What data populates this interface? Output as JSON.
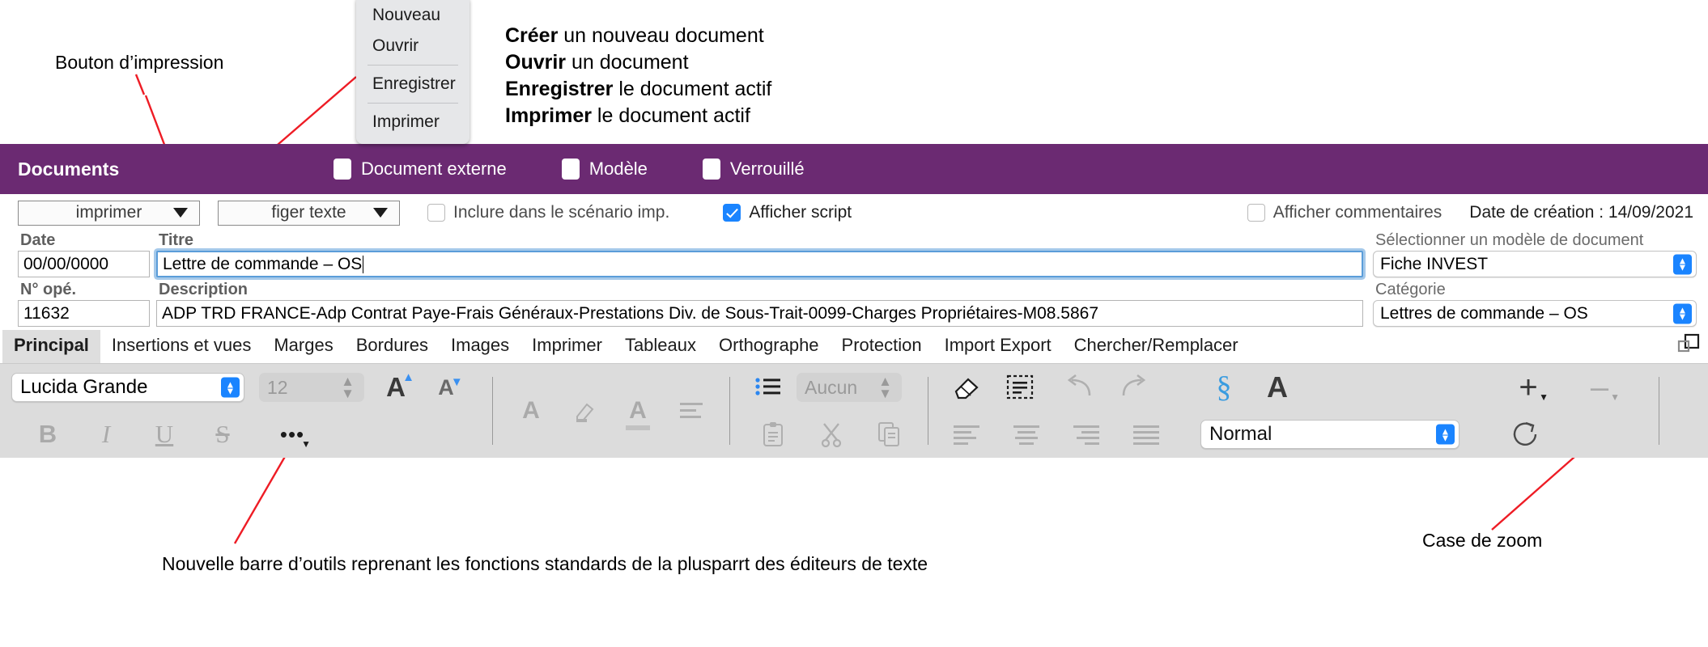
{
  "annotations": {
    "print_button": "Bouton d’impression",
    "toolbar_note": "Nouvelle barre d’outils reprenant les fonctions standards de la plusparrt des éditeurs de texte",
    "zoom_case": "Case de zoom"
  },
  "legend": [
    {
      "bold": "Créer",
      "rest": " un nouveau document"
    },
    {
      "bold": "Ouvrir",
      "rest": " un document"
    },
    {
      "bold": "Enregistrer",
      "rest": " le document actif"
    },
    {
      "bold": "Imprimer",
      "rest": " le document actif"
    }
  ],
  "menu": {
    "items": [
      {
        "label": "Nouveau",
        "sep_after": false
      },
      {
        "label": "Ouvrir",
        "sep_after": true
      },
      {
        "label": "Enregistrer",
        "sep_after": true
      },
      {
        "label": "Imprimer",
        "sep_after": false
      }
    ]
  },
  "titlebar": {
    "title": "Documents",
    "accent_color": "#6b2a72",
    "checks": [
      {
        "label": "Document externe",
        "checked": false
      },
      {
        "label": "Modèle",
        "checked": false
      },
      {
        "label": "Verrouillé",
        "checked": false
      }
    ]
  },
  "options": {
    "action_pulldown": "imprimer",
    "text_pulldown": "figer texte",
    "include_scenario": {
      "label": "Inclure dans le scénario imp.",
      "checked": false
    },
    "show_script": {
      "label": "Afficher script",
      "checked": true
    },
    "show_comments": {
      "label": "Afficher commentaires",
      "checked": false
    },
    "creation_date": "Date de création : 14/09/2021"
  },
  "fields": {
    "date_label": "Date",
    "date_value": "00/00/0000",
    "title_label": "Titre",
    "title_value": "Lettre de commande – OS",
    "ope_label": "N° opé.",
    "ope_value": "11632",
    "description_label": "Description",
    "description_value": "ADP TRD FRANCE-Adp Contrat Paye-Frais Généraux-Prestations Div. de Sous-Trait-0099-Charges Propriétaires-M08.5867",
    "template_label": "Sélectionner un modèle de document",
    "template_value": "Fiche INVEST",
    "category_label": "Catégorie",
    "category_value": "Lettres de commande – OS"
  },
  "tabs": [
    {
      "label": "Principal",
      "active": true
    },
    {
      "label": "Insertions et vues",
      "active": false
    },
    {
      "label": "Marges",
      "active": false
    },
    {
      "label": "Bordures",
      "active": false
    },
    {
      "label": "Images",
      "active": false
    },
    {
      "label": "Imprimer",
      "active": false
    },
    {
      "label": "Tableaux",
      "active": false
    },
    {
      "label": "Orthographe",
      "active": false
    },
    {
      "label": "Protection",
      "active": false
    },
    {
      "label": "Import Export",
      "active": false
    },
    {
      "label": "Chercher/Remplacer",
      "active": false
    }
  ],
  "toolbar": {
    "font_family": "Lucida Grande",
    "font_size": "12",
    "list_style": "Aucun",
    "paragraph_style": "Normal",
    "grow_font": "A",
    "shrink_font": "A",
    "bold": "B",
    "italic": "I",
    "underline": "U",
    "strike": "S",
    "more": "•••",
    "section": "§",
    "letter": "A",
    "plus": "+",
    "minus": "–"
  }
}
